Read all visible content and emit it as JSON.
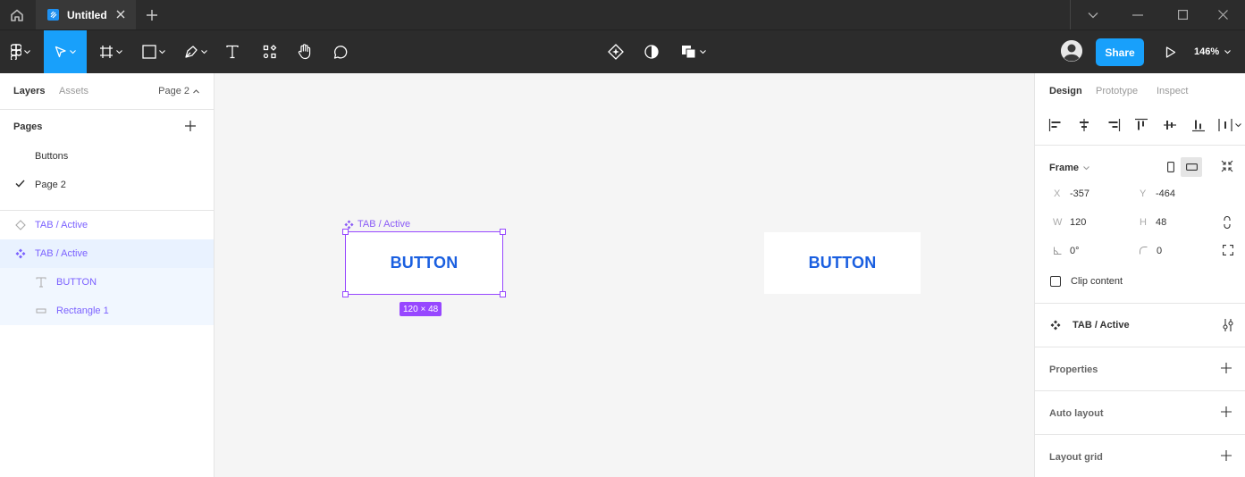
{
  "titlebar": {
    "home_icon": "home-icon",
    "tab_title": "Untitled",
    "tab_icon": "figma-file-icon",
    "close_icon": "close-icon",
    "new_tab_icon": "plus-icon",
    "window_controls": [
      "chevron-down-icon",
      "minimize-icon",
      "maximize-icon",
      "close-icon"
    ]
  },
  "toolbar": {
    "tools": [
      "main-menu",
      "move-tool",
      "frame-tool",
      "shape-tool",
      "pen-tool",
      "text-tool",
      "resources-tool",
      "hand-tool",
      "comment-tool"
    ],
    "center_tools": [
      "component-tool",
      "mask-tool",
      "boolean-tool"
    ],
    "share_label": "Share",
    "zoom_label": "146%",
    "accent": "#18a0fb"
  },
  "left_panel": {
    "tabs": [
      {
        "label": "Layers",
        "active": true
      },
      {
        "label": "Assets",
        "active": false
      }
    ],
    "page_select": "Page 2",
    "pages_title": "Pages",
    "pages": [
      {
        "label": "Buttons",
        "current": false
      },
      {
        "label": "Page 2",
        "current": true
      }
    ],
    "layers": [
      {
        "label": "TAB / Active",
        "icon": "component-instance-icon",
        "level": 0
      },
      {
        "label": "TAB / Active",
        "icon": "component-icon",
        "level": 0
      },
      {
        "label": "BUTTON",
        "icon": "text-icon",
        "level": 1
      },
      {
        "label": "Rectangle 1",
        "icon": "rectangle-icon",
        "level": 1
      }
    ]
  },
  "canvas": {
    "frame_label": "TAB / Active",
    "button_text": "BUTTON",
    "size_badge": "120 × 48",
    "copy_button_text": "BUTTON",
    "selection_color": "#9747ff",
    "button_text_color": "#1a5fe0"
  },
  "right_panel": {
    "tabs": [
      {
        "label": "Design",
        "active": true
      },
      {
        "label": "Prototype",
        "active": false
      },
      {
        "label": "Inspect",
        "active": false
      }
    ],
    "frame_title": "Frame",
    "x_label": "X",
    "x_value": "-357",
    "y_label": "Y",
    "y_value": "-464",
    "w_label": "W",
    "w_value": "120",
    "h_label": "H",
    "h_value": "48",
    "rotation_value": "0°",
    "radius_value": "0",
    "clip_content_label": "Clip content",
    "component_name": "TAB / Active",
    "sections": [
      "Properties",
      "Auto layout",
      "Layout grid"
    ]
  }
}
